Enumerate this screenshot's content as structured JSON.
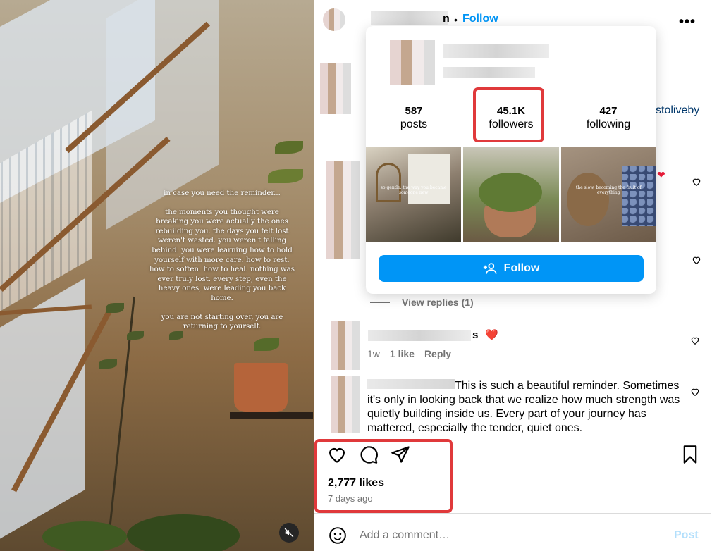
{
  "media": {
    "overlay_text": [
      "in case you need the reminder...",
      "the moments you thought were breaking you were actually the ones rebuilding you. the days you felt lost weren't wasted. you weren't falling behind. you were learning how to hold yourself with more care. how to rest. how to soften. how to heal. nothing was ever truly lost. every step, even the heavy ones, were leading you back home.",
      "you are not starting over, you are returning to yourself."
    ],
    "mute_icon": "speaker-muted-icon"
  },
  "header": {
    "username_suffix": "n",
    "separator": "•",
    "follow_label": "Follow",
    "more_label": "•••"
  },
  "caption_link": "stoliveby",
  "profile_card": {
    "stats": [
      {
        "value": "587",
        "label": "posts"
      },
      {
        "value": "45.1K",
        "label": "followers"
      },
      {
        "value": "427",
        "label": "following"
      }
    ],
    "thumbnails": [
      {
        "icon": "window-mirror-photo",
        "caption": "so gentle. the way you became someone new"
      },
      {
        "icon": "potted-herb-photo",
        "caption": ""
      },
      {
        "icon": "blueberries-bowl-photo",
        "caption": "the slow, becoming the fruit of everything"
      }
    ],
    "follow_button": "Follow"
  },
  "comments": {
    "view_replies": "View replies (1)",
    "comment1": {
      "name_suffix": "s",
      "heart": "❤️",
      "time": "1w",
      "likes": "1 like",
      "reply": "Reply"
    },
    "comment2": {
      "text": "This is such a beautiful reminder. Sometimes it's only in looking back that we realize how much strength was quietly building inside us. Every part of your journey has mattered, especially the tender, quiet ones."
    }
  },
  "actions": {
    "likes": "2,777 likes",
    "time": "7 days ago"
  },
  "add_comment": {
    "placeholder": "Add a comment…",
    "post_label": "Post"
  },
  "colors": {
    "accent": "#0095f6",
    "highlight": "#e0393b",
    "muted": "#737373",
    "heart": "#ed1c3a"
  }
}
